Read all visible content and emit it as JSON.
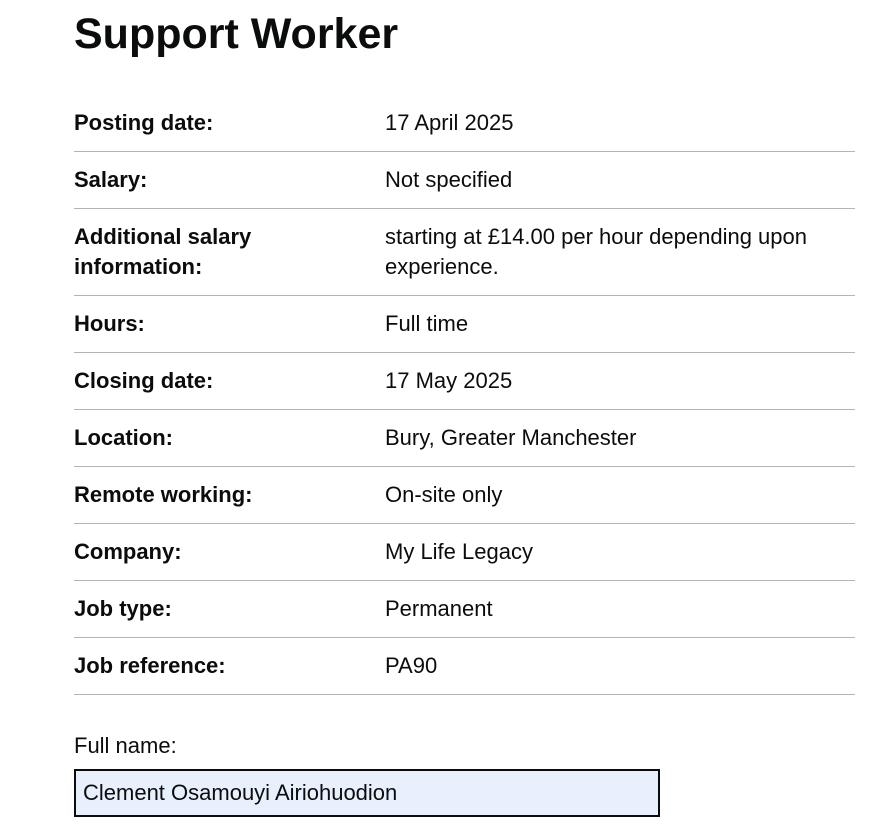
{
  "page_title": "Support Worker",
  "job_details": [
    {
      "key": "Posting date:",
      "value": "17 April 2025"
    },
    {
      "key": "Salary:",
      "value": "Not specified"
    },
    {
      "key": "Additional salary information:",
      "value": "starting at £14.00 per hour depending upon experience."
    },
    {
      "key": "Hours:",
      "value": "Full time"
    },
    {
      "key": "Closing date:",
      "value": "17 May 2025"
    },
    {
      "key": "Location:",
      "value": "Bury, Greater Manchester"
    },
    {
      "key": "Remote working:",
      "value": "On-site only"
    },
    {
      "key": "Company:",
      "value": "My Life Legacy"
    },
    {
      "key": "Job type:",
      "value": "Permanent"
    },
    {
      "key": "Job reference:",
      "value": "PA90"
    }
  ],
  "form": {
    "full_name_label": "Full name:",
    "full_name_value": "Clement Osamouyi Airiohuodion"
  },
  "colors": {
    "text": "#0b0c0c",
    "divider": "#b1b4b6",
    "input_autofill_background": "#e8f0fe"
  }
}
